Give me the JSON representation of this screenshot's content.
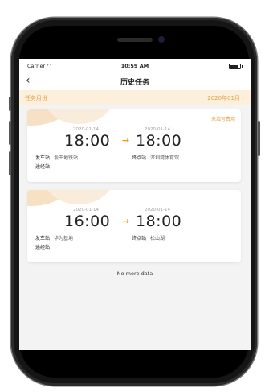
{
  "status_bar": {
    "carrier": "Carrier",
    "time": "10:59 AM",
    "battery_level": 0.85
  },
  "nav": {
    "back": "‹",
    "title": "历史任务"
  },
  "month_filter": {
    "label": "任务月份",
    "value": "2020年01月 ›"
  },
  "tasks": [
    {
      "badge": "未填写费用",
      "start_date": "2020-01-14",
      "start_time": "18:00",
      "end_date": "2020-01-14",
      "end_time": "18:00",
      "arrow": "→",
      "departure_label": "发车站",
      "departure_value": "坂田地铁站",
      "terminal_label": "终点站",
      "terminal_value": "深圳湾体育馆",
      "via_label": "途经站",
      "via_value": ""
    },
    {
      "badge": "",
      "start_date": "2020-01-14",
      "start_time": "16:00",
      "end_date": "2020-01-14",
      "end_time": "18:00",
      "arrow": "→",
      "departure_label": "发车站",
      "departure_value": "华为基地",
      "terminal_label": "终点站",
      "terminal_value": "松山湖",
      "via_label": "途经站",
      "via_value": ""
    }
  ],
  "footer": {
    "text": "No more data"
  },
  "colors": {
    "accent": "#f3931f",
    "month_bg": "#fcefdc",
    "month_text": "#e3a148"
  }
}
